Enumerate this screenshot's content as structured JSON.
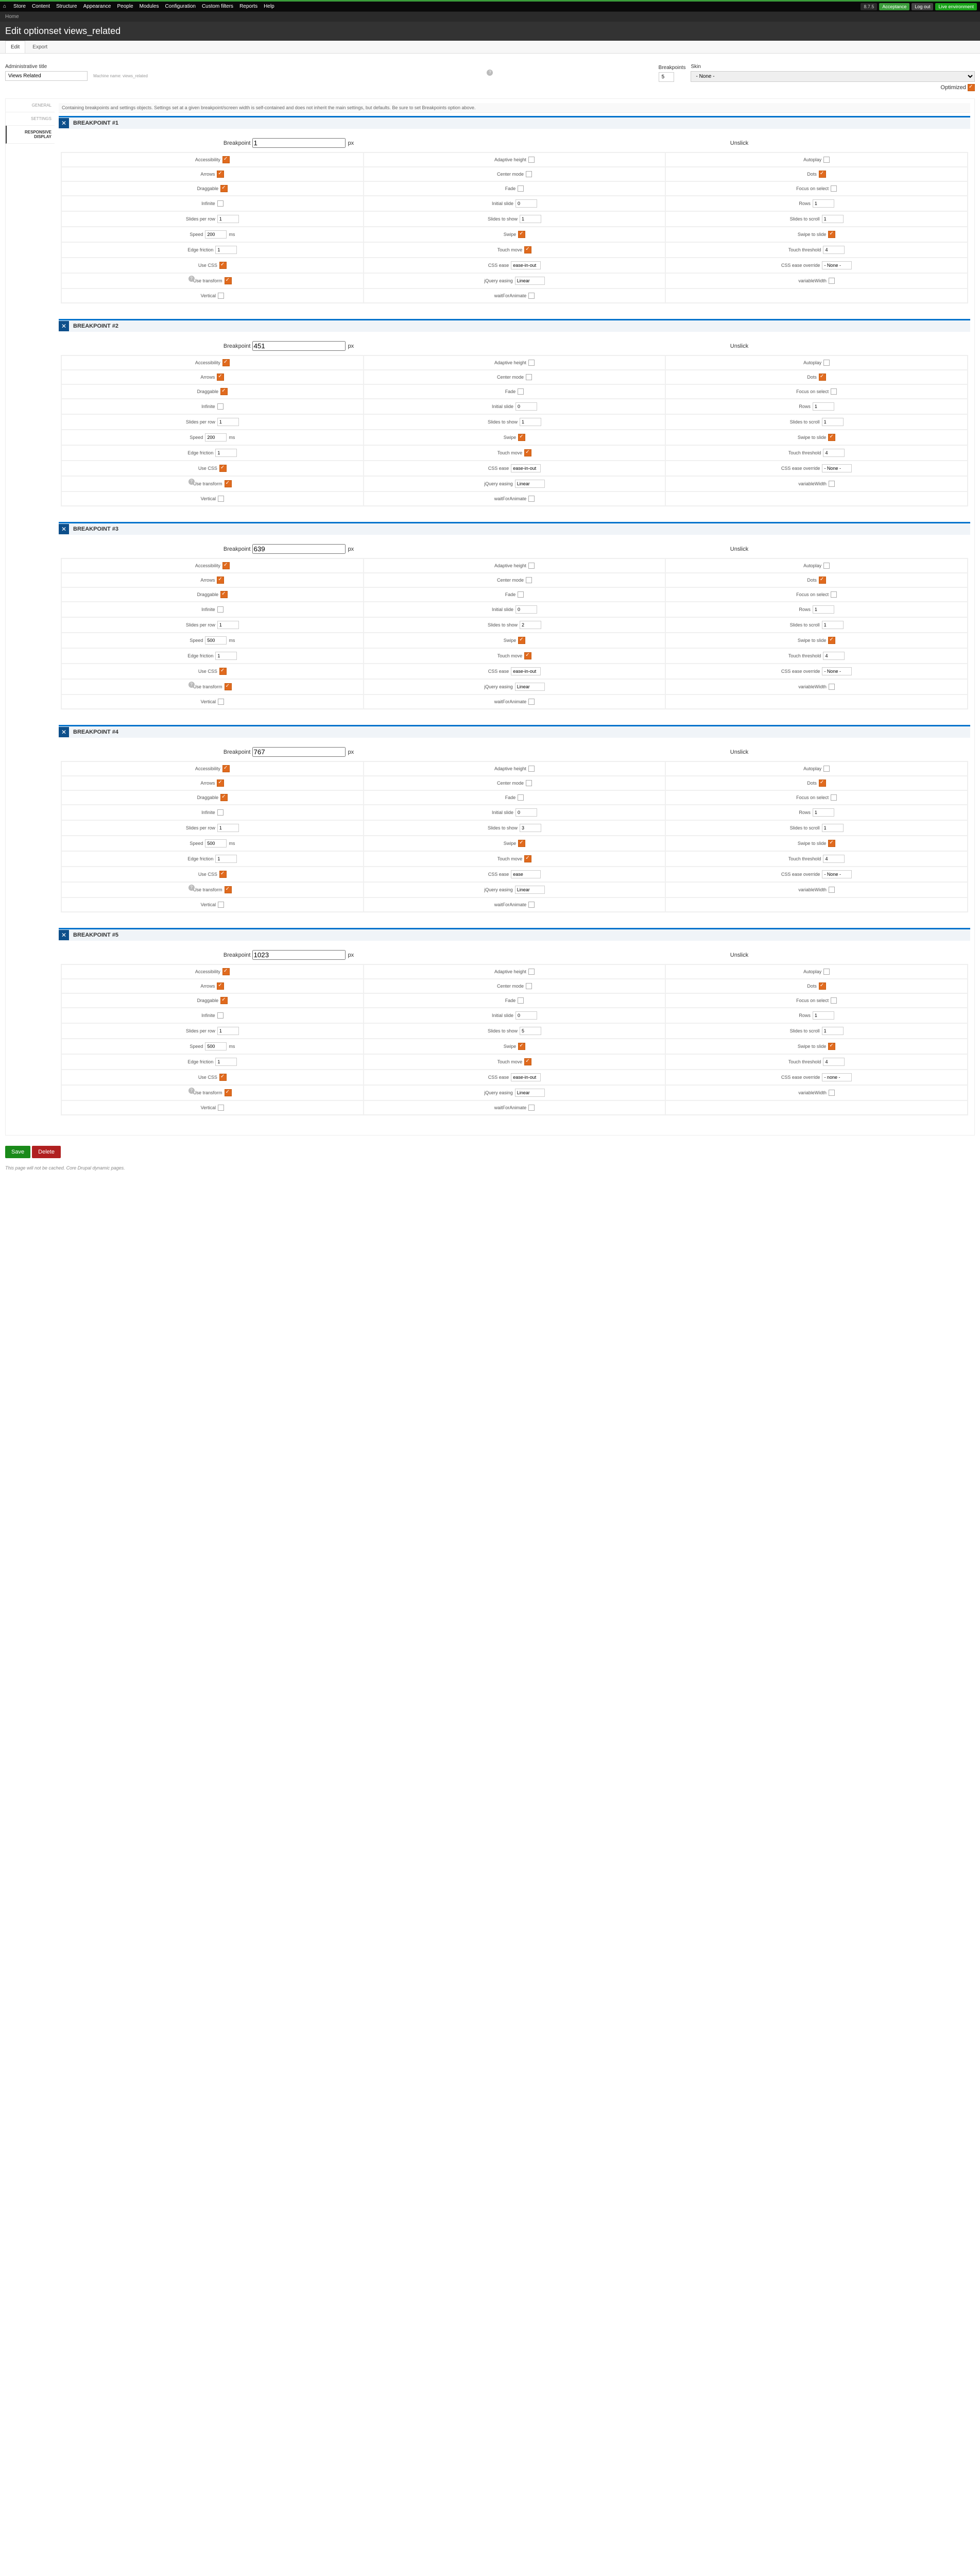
{
  "adminMenu": [
    "Store",
    "Content",
    "Structure",
    "Appearance",
    "People",
    "Modules",
    "Configuration",
    "Custom filters",
    "Reports",
    "Help"
  ],
  "adminRight": {
    "version": "8.7.5",
    "accept": "Acceptance",
    "logout": "Log out",
    "env": "Live environment"
  },
  "breadcrumb": "Home",
  "pageTitle": "Edit optionset views_related",
  "tabs": {
    "edit": "Edit",
    "export": "Export"
  },
  "form": {
    "adminTitleLabel": "Administrative title",
    "adminTitleValue": "Views Related",
    "machineName": "Machine name: views_related",
    "breakpointsLabel": "Breakpoints",
    "breakpointsValue": "5",
    "skinLabel": "Skin",
    "skinValue": "- None -",
    "optimizedLabel": "Optimized"
  },
  "vertTabs": [
    "GENERAL",
    "SETTINGS",
    "RESPONSIVE DISPLAY"
  ],
  "infoText": "Containing breakpoints and settings objects. Settings set at a given breakpoint/screen width is self-contained and does not inherit the main settings, but defaults. Be sure to set Breakpoints option above.",
  "bpLabels": {
    "breakpoint": "Breakpoint",
    "px": "px",
    "unslick": "Unslick",
    "accessibility": "Accessibility",
    "adaptiveHeight": "Adaptive height",
    "autoplay": "Autoplay",
    "arrows": "Arrows",
    "centerMode": "Center mode",
    "dots": "Dots",
    "draggable": "Draggable",
    "fade": "Fade",
    "focusOnSelect": "Focus on select",
    "infinite": "Infinite",
    "initialSlide": "Initial slide",
    "rows": "Rows",
    "slidesPerRow": "Slides per row",
    "slidesToShow": "Slides to show",
    "slidesToScroll": "Slides to scroll",
    "speed": "Speed",
    "ms": "ms",
    "swipe": "Swipe",
    "swipeToSlide": "Swipe to slide",
    "edgeFriction": "Edge friction",
    "touchMove": "Touch move",
    "touchThreshold": "Touch threshold",
    "useCSS": "Use CSS",
    "cssEase": "CSS ease",
    "cssEaseOverride": "CSS ease override",
    "useTransform": "Use transform",
    "jqueryEasing": "jQuery easing",
    "variableWidth": "variableWidth",
    "vertical": "Vertical",
    "waitForAnimate": "waitForAnimate"
  },
  "breakpoints": [
    {
      "n": 1,
      "title": "BREAKPOINT #1",
      "bp": "1",
      "initialSlide": "0",
      "rows": "1",
      "slidesPerRow": "1",
      "slidesToShow": "1",
      "slidesToScroll": "1",
      "speed": "200",
      "edgeFriction": "1",
      "touchThreshold": "4",
      "cssEase": "ease-in-out",
      "cssOverride": "- None -",
      "jquery": "Linear"
    },
    {
      "n": 2,
      "title": "BREAKPOINT #2",
      "bp": "451",
      "initialSlide": "0",
      "rows": "1",
      "slidesPerRow": "1",
      "slidesToShow": "1",
      "slidesToScroll": "1",
      "speed": "200",
      "edgeFriction": "1",
      "touchThreshold": "4",
      "cssEase": "ease-in-out",
      "cssOverride": "- None -",
      "jquery": "Linear"
    },
    {
      "n": 3,
      "title": "BREAKPOINT #3",
      "bp": "639",
      "initialSlide": "0",
      "rows": "1",
      "slidesPerRow": "1",
      "slidesToShow": "2",
      "slidesToScroll": "1",
      "speed": "500",
      "edgeFriction": "1",
      "touchThreshold": "4",
      "cssEase": "ease-in-out",
      "cssOverride": "- None -",
      "jquery": "Linear"
    },
    {
      "n": 4,
      "title": "BREAKPOINT #4",
      "bp": "767",
      "initialSlide": "0",
      "rows": "1",
      "slidesPerRow": "1",
      "slidesToShow": "3",
      "slidesToScroll": "1",
      "speed": "500",
      "edgeFriction": "1",
      "touchThreshold": "4",
      "cssEase": "ease",
      "cssOverride": "- None -",
      "jquery": "Linear"
    },
    {
      "n": 5,
      "title": "BREAKPOINT #5",
      "bp": "1023",
      "initialSlide": "0",
      "rows": "1",
      "slidesPerRow": "1",
      "slidesToShow": "5",
      "slidesToScroll": "1",
      "speed": "500",
      "edgeFriction": "1",
      "touchThreshold": "4",
      "cssEase": "ease-in-out",
      "cssOverride": "- none -",
      "jquery": "Linear"
    }
  ],
  "actions": {
    "save": "Save",
    "delete": "Delete"
  },
  "footerNote": "This page will not be cached. Core Drupal dynamic pages."
}
